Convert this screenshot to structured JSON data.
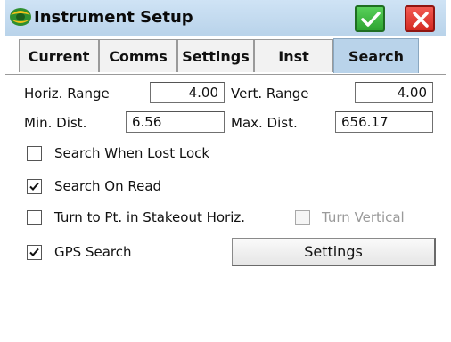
{
  "window": {
    "title": "Instrument Setup",
    "icon": "instrument-logo-icon",
    "ok_icon": "checkmark-icon",
    "cancel_icon": "close-x-icon"
  },
  "tabs": [
    {
      "label": "Current",
      "active": false
    },
    {
      "label": "Comms",
      "active": false
    },
    {
      "label": "Settings",
      "active": false
    },
    {
      "label": "Inst",
      "active": false
    },
    {
      "label": "Search",
      "active": true
    }
  ],
  "search": {
    "horiz_range": {
      "label": "Horiz. Range",
      "value": "4.00"
    },
    "vert_range": {
      "label": "Vert. Range",
      "value": "4.00"
    },
    "min_dist": {
      "label": "Min. Dist.",
      "value": "6.56"
    },
    "max_dist": {
      "label": "Max. Dist.",
      "value": "656.17"
    },
    "options": [
      {
        "label": "Search When Lost Lock",
        "checked": false,
        "enabled": true
      },
      {
        "label": "Search On Read",
        "checked": true,
        "enabled": true
      },
      {
        "label": "Turn to Pt. in Stakeout Horiz.",
        "checked": false,
        "enabled": true
      },
      {
        "label": "Turn Vertical",
        "checked": false,
        "enabled": false
      },
      {
        "label": "GPS Search",
        "checked": true,
        "enabled": true
      }
    ],
    "settings_button": "Settings"
  },
  "colors": {
    "title_bar": "#b9d3ea",
    "active_tab": "#b9d3ea",
    "ok_button": "#2ea431",
    "cancel_button": "#d42a22",
    "disabled_text": "#9a9a9a"
  }
}
